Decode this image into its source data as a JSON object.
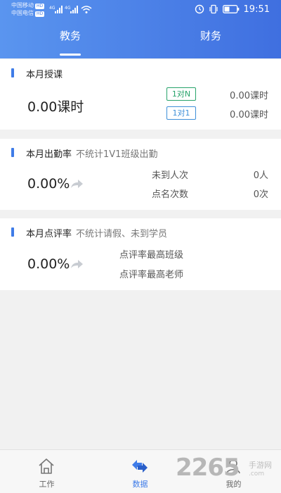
{
  "statusbar": {
    "carrier1": "中国移动",
    "carrier2": "中国电信",
    "hd": "HD",
    "net": "4G",
    "time": "19:51"
  },
  "tabs": [
    {
      "label": "教务",
      "active": true
    },
    {
      "label": "财务",
      "active": false
    }
  ],
  "lessons": {
    "title": "本月授课",
    "total": "0.00课时",
    "rows": [
      {
        "badge": "1对N",
        "value": "0.00课时"
      },
      {
        "badge": "1对1",
        "value": "0.00课时"
      }
    ]
  },
  "attendance": {
    "title": "本月出勤率",
    "note": "不统计1V1班级出勤",
    "rate": "0.00%",
    "rows": [
      {
        "label": "未到人次",
        "value": "0人"
      },
      {
        "label": "点名次数",
        "value": "0次"
      }
    ]
  },
  "review": {
    "title": "本月点评率",
    "note": "不统计请假、未到学员",
    "rate": "0.00%",
    "rows": [
      {
        "label": "点评率最高班级"
      },
      {
        "label": "点评率最高老师"
      }
    ]
  },
  "bottomnav": [
    {
      "label": "工作",
      "icon": "home-icon",
      "active": false
    },
    {
      "label": "数据",
      "icon": "data-icon",
      "active": true
    },
    {
      "label": "我的",
      "icon": "profile-icon",
      "active": false
    }
  ],
  "watermark": {
    "number": "2265",
    "text": "手游网",
    "url": ".com"
  },
  "colors": {
    "header_start": "#5a95ef",
    "header_end": "#3f6fe0",
    "accent": "#3f7ce8",
    "badge_green": "#27a36a",
    "badge_blue": "#3e8fd8"
  }
}
